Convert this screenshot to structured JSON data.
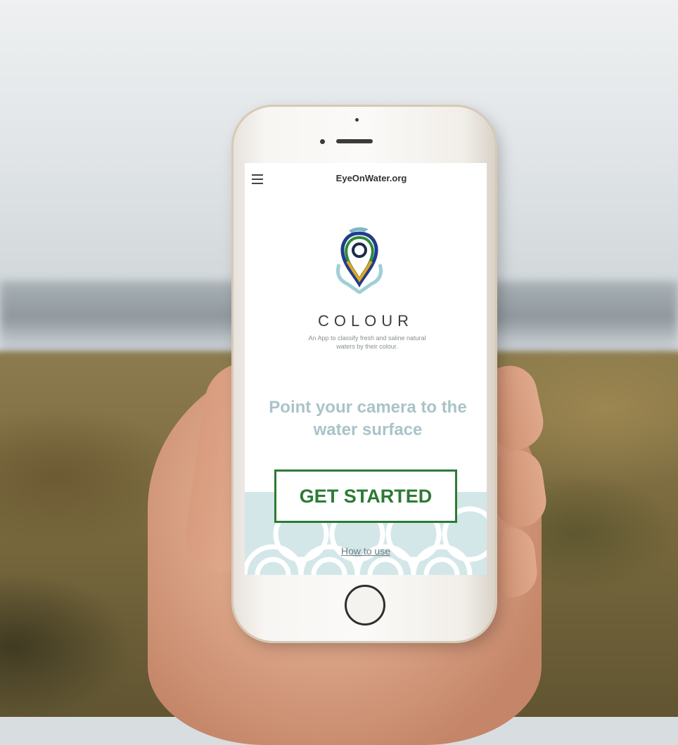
{
  "app": {
    "title": "EyeOnWater.org",
    "brand": "COLOUR",
    "tagline": "An App to classify fresh and saline natural waters by their colour.",
    "headline": "Point your camera to the water surface"
  },
  "actions": {
    "start_label": "GET STARTED",
    "howto_label": "How to use"
  },
  "icons": {
    "menu": "menu-icon",
    "logo": "water-drop-location-logo"
  },
  "colors": {
    "start_button": "#2c7a35",
    "headline": "#a9c4c8",
    "waves": "#cfe4e6"
  }
}
